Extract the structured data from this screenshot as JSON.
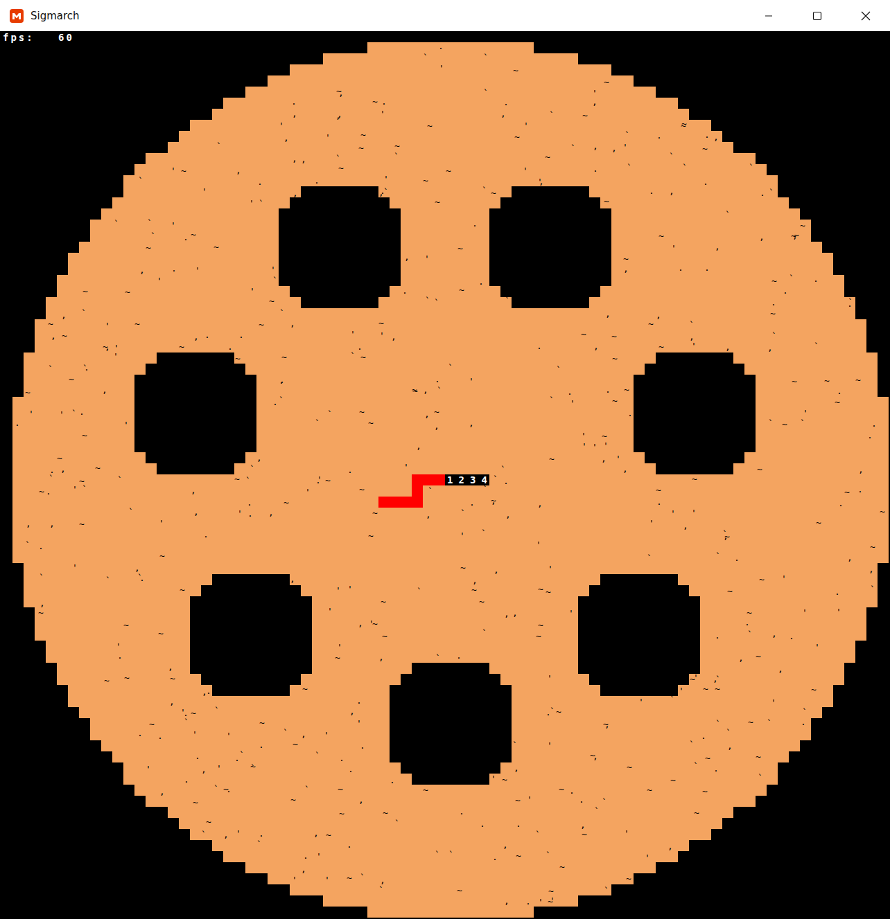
{
  "window": {
    "title": "Sigmarch"
  },
  "hud": {
    "fps_label": "fps:",
    "fps_value": "60"
  },
  "snake": {
    "label": "1234"
  },
  "terrain": {
    "glyphs": [
      "~",
      ".",
      "`",
      ",",
      "'"
    ]
  }
}
